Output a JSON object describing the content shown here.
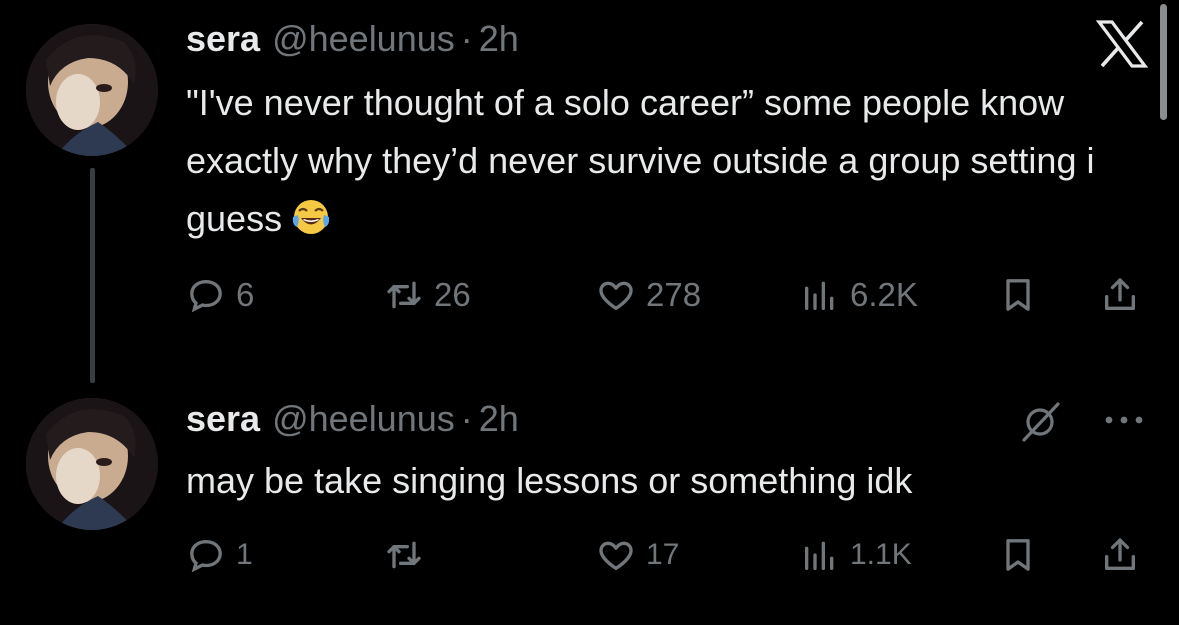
{
  "colors": {
    "background": "#000000",
    "primary_text": "#e7e9ea",
    "secondary_text": "#71767b",
    "thread_line": "#3a3d40"
  },
  "tweets": [
    {
      "name": "sera",
      "handle": "@heelunus",
      "separator": "·",
      "time": "2h",
      "text": "\"I've never thought of a solo career” some people know exactly why they’d never survive outside a group setting i guess",
      "emoji": "face-with-tears-of-joy",
      "counts": {
        "replies": "6",
        "retweets": "26",
        "likes": "278",
        "views": "6.2K"
      },
      "icons": [
        "reply-icon",
        "retweet-icon",
        "like-icon",
        "views-icon",
        "bookmark-icon",
        "share-icon"
      ]
    },
    {
      "name": "sera",
      "handle": "@heelunus",
      "separator": "·",
      "time": "2h",
      "text": "may be take singing lessons or something idk",
      "counts": {
        "replies": "1",
        "retweets": "",
        "likes": "17",
        "views": "1.1K"
      },
      "icons": [
        "reply-icon",
        "retweet-icon",
        "like-icon",
        "views-icon",
        "bookmark-icon",
        "share-icon"
      ]
    }
  ],
  "top_right": {
    "logo": "x-logo",
    "grok": "grok-icon",
    "more": "more-icon"
  }
}
